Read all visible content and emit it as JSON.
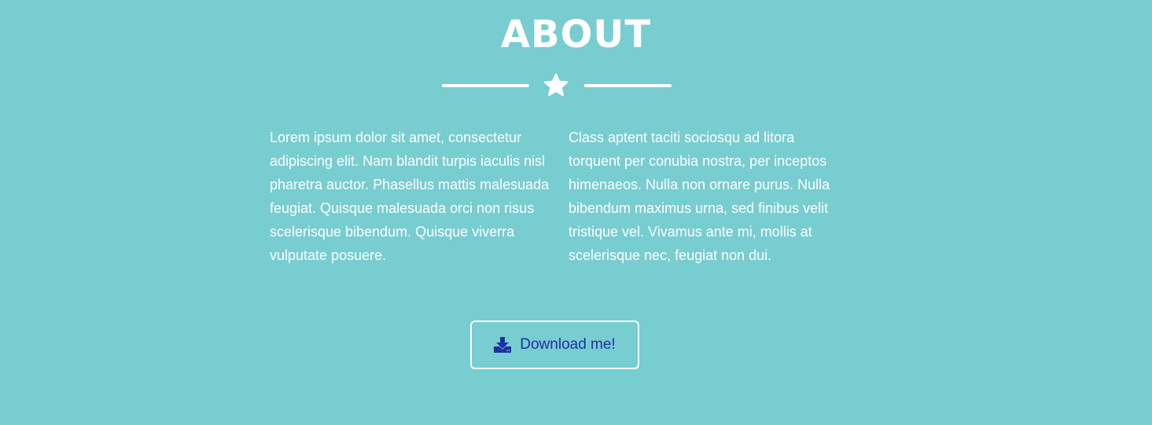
{
  "about": {
    "title": "ABOUT",
    "divider_icon": "star-icon",
    "left_paragraph": "Lorem ipsum dolor sit amet, consectetur adipiscing elit. Nam blandit turpis iaculis nisl pharetra auctor. Phasellus mattis malesuada feugiat. Quisque malesuada orci non risus scelerisque bibendum. Quisque viverra vulputate posuere.",
    "right_paragraph": "Class aptent taciti sociosqu ad litora torquent per conubia nostra, per inceptos himenaeos. Nulla non ornare purus. Nulla bibendum maximus urna, sed finibus velit tristique vel. Vivamus ante mi, mollis at scelerisque nec, feugiat non dui.",
    "download_label": "Download me!",
    "download_icon": "download-icon"
  },
  "colors": {
    "background": "#78cdd1",
    "text": "#ffffff",
    "button_text": "#1f2fa6"
  }
}
